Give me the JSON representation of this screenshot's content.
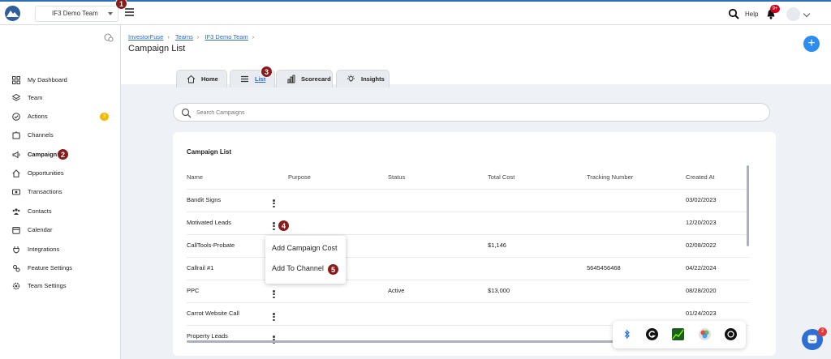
{
  "topbar": {
    "team_name": "IF3 Demo Team",
    "help_label": "Help",
    "notification_badge": "9+"
  },
  "steps": [
    "1",
    "2",
    "3",
    "4",
    "5"
  ],
  "sidebar": {
    "items": [
      {
        "label": "My Dashboard",
        "icon": "grid-icon"
      },
      {
        "label": "Team",
        "icon": "layers-icon"
      },
      {
        "label": "Actions",
        "icon": "check-circle-icon",
        "badge": "3"
      },
      {
        "label": "Channels",
        "icon": "puzzle-icon"
      },
      {
        "label": "Campaigns",
        "icon": "megaphone-icon",
        "active": true
      },
      {
        "label": "Opportunities",
        "icon": "home-icon"
      },
      {
        "label": "Transactions",
        "icon": "money-icon"
      },
      {
        "label": "Contacts",
        "icon": "users-icon"
      },
      {
        "label": "Calendar",
        "icon": "calendar-icon"
      },
      {
        "label": "Integrations",
        "icon": "plug-icon"
      },
      {
        "label": "Feature Settings",
        "icon": "cogs-icon"
      },
      {
        "label": "Team Settings",
        "icon": "gear-icon"
      }
    ]
  },
  "header": {
    "breadcrumb": [
      "InvestorFuse",
      "Teams",
      "IF3 Demo Team"
    ],
    "title": "Campaign List",
    "add_button": "+"
  },
  "tabs": [
    {
      "label": "Home",
      "icon": "home-icon"
    },
    {
      "label": "List",
      "icon": "list-icon",
      "active": true
    },
    {
      "label": "Scorecard",
      "icon": "bar-chart-icon"
    },
    {
      "label": "Insights",
      "icon": "lightbulb-icon"
    }
  ],
  "search": {
    "placeholder": "Search Campaigns"
  },
  "table": {
    "title": "Campaign List",
    "columns": [
      "Name",
      "Purpose",
      "Status",
      "Total Cost",
      "Tracking Number",
      "Created At"
    ],
    "rows": [
      {
        "name": "Bandit Signs",
        "purpose": "",
        "status": "",
        "cost": "",
        "tracking": "",
        "created": "03/02/2023"
      },
      {
        "name": "Motivated Leads",
        "purpose": "",
        "status": "",
        "cost": "",
        "tracking": "",
        "created": "12/20/2023"
      },
      {
        "name": "CallTools-Probate",
        "purpose": "",
        "status": "",
        "cost": "$1,146",
        "tracking": "",
        "created": "02/08/2022"
      },
      {
        "name": "Callrail #1",
        "purpose": "",
        "status": "",
        "cost": "",
        "tracking": "5645456468",
        "created": "04/22/2024"
      },
      {
        "name": "PPC",
        "purpose": "",
        "status": "Active",
        "cost": "$13,000",
        "tracking": "",
        "created": "08/28/2020"
      },
      {
        "name": "Carrot Website Call",
        "purpose": "",
        "status": "",
        "cost": "",
        "tracking": "",
        "created": "01/24/2023"
      },
      {
        "name": "Property Leads",
        "purpose": "",
        "status": "",
        "cost": "",
        "tracking": "",
        "created": ""
      }
    ]
  },
  "row_menu": {
    "items": [
      "Add Campaign Cost",
      "Add To Channel"
    ]
  },
  "chat_badge": "2"
}
